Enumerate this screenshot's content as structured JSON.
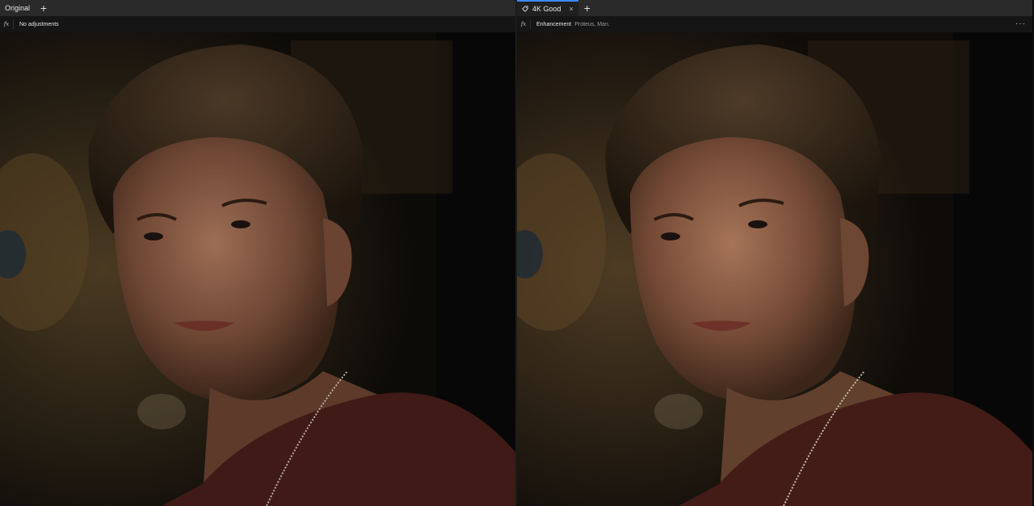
{
  "left_pane": {
    "tab_label": "Original",
    "add_tab_symbol": "+",
    "fx_symbol": "fx",
    "adjustments_label": "No adjustments",
    "image_alt": "portrait-photo-original"
  },
  "right_pane": {
    "tab_label": "4K Good",
    "tab_icon": "tag-icon",
    "close_symbol": "×",
    "add_tab_symbol": "+",
    "fx_symbol": "fx",
    "enhancement_label": "Enhancement",
    "enhancement_detail": "Proteus, Man.",
    "more_symbol": "···",
    "image_alt": "portrait-photo-enhanced"
  },
  "colors": {
    "accent": "#3b8cff",
    "tabbar_bg": "#2a2a2a",
    "subbar_bg": "#151515",
    "photo_bg": "#0c0c0c",
    "shirt": "#3f1a16",
    "skin": "#8a5f48"
  }
}
